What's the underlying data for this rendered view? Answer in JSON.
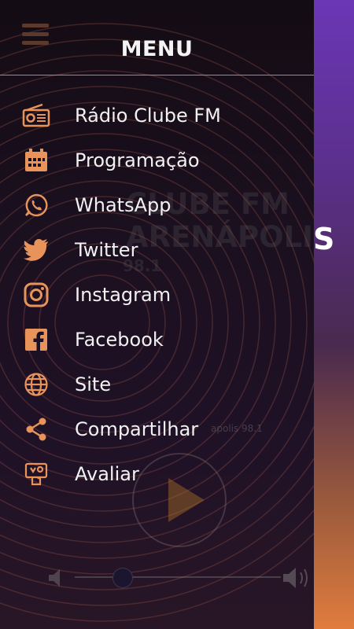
{
  "background": {
    "title_fragment": "S"
  },
  "drawer": {
    "title": "MENU",
    "items": [
      {
        "label": "Rádio Clube FM",
        "icon": "radio-icon"
      },
      {
        "label": "Programação",
        "icon": "calendar-icon"
      },
      {
        "label": "WhatsApp",
        "icon": "whatsapp-icon"
      },
      {
        "label": "Twitter",
        "icon": "twitter-icon"
      },
      {
        "label": "Instagram",
        "icon": "instagram-icon"
      },
      {
        "label": "Facebook",
        "icon": "facebook-icon"
      },
      {
        "label": "Site",
        "icon": "globe-icon"
      },
      {
        "label": "Compartilhar",
        "icon": "share-icon"
      },
      {
        "label": "Avaliar",
        "icon": "rate-icon"
      }
    ],
    "icon_color": "#e8935a"
  },
  "ghost": {
    "logo_line1": "CLUBE FM",
    "logo_line2": "ARENÁPOLIS",
    "frequency": "98.1",
    "subtitle_fragment": "apolis 98.1"
  },
  "player": {
    "volume_level": 0.23
  }
}
